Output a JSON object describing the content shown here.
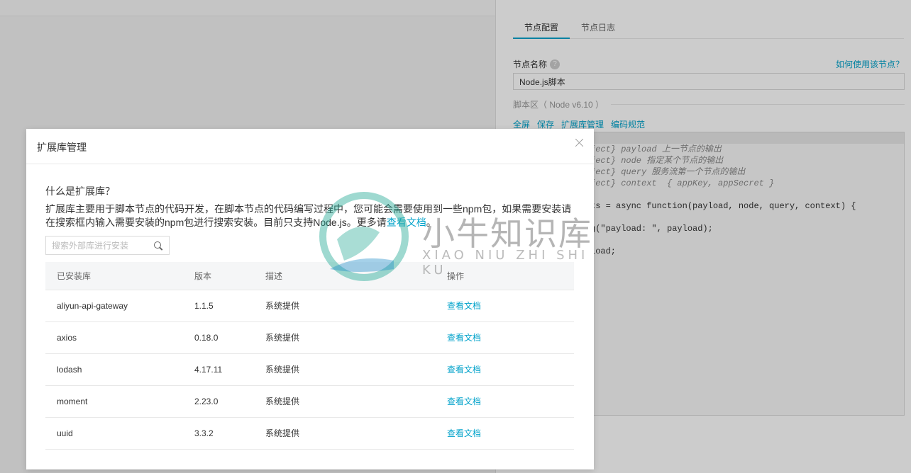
{
  "config_panel": {
    "tabs": [
      {
        "label": "节点配置",
        "active": true
      },
      {
        "label": "节点日志",
        "active": false
      }
    ],
    "node_name_label": "节点名称",
    "help_link": "如何使用该节点？",
    "node_name_value": "Node.js脚本",
    "script_area_label": "脚本区（ Node v6.10 ）",
    "actions": [
      "全屏",
      "保存",
      "扩展库管理",
      "编码规范"
    ],
    "code_lines": [
      "",
      "ject} payload 上一节点的输出",
      "ject} node 指定某个节点的输出",
      "ject} query 服务流第一个节点的输出",
      "ject} context  { appKey, appSecret }",
      "",
      "ts = async function(payload, node, query, context) {",
      "",
      "g(\"payload: \", payload);",
      "",
      "load;"
    ]
  },
  "modal": {
    "title": "扩展库管理",
    "intro_title": "什么是扩展库？",
    "intro_text": "扩展库主要用于脚本节点的代码开发，在脚本节点的代码编写过程中，您可能会需要使用到一些npm包，如果需要安装请在搜索框内输入需要安装的npm包进行搜索安装。目前只支持Node.js。更多请",
    "intro_link": "查看文档",
    "intro_end": "。",
    "search_placeholder": "搜索外部库进行安装",
    "table": {
      "headers": [
        "已安装库",
        "版本",
        "描述",
        "操作"
      ],
      "rows": [
        {
          "name": "aliyun-api-gateway",
          "version": "1.1.5",
          "desc": "系统提供",
          "action": "查看文档"
        },
        {
          "name": "axios",
          "version": "0.18.0",
          "desc": "系统提供",
          "action": "查看文档"
        },
        {
          "name": "lodash",
          "version": "4.17.11",
          "desc": "系统提供",
          "action": "查看文档"
        },
        {
          "name": "moment",
          "version": "2.23.0",
          "desc": "系统提供",
          "action": "查看文档"
        },
        {
          "name": "uuid",
          "version": "3.3.2",
          "desc": "系统提供",
          "action": "查看文档"
        }
      ]
    }
  },
  "watermark": {
    "cn": "小牛知识库",
    "en": "XIAO NIU ZHI SHI KU"
  },
  "colors": {
    "accent": "#00a2ca",
    "overlay": "rgba(0,0,0,0.2)"
  },
  "icons": [
    "help-icon",
    "close-icon",
    "search-icon"
  ]
}
